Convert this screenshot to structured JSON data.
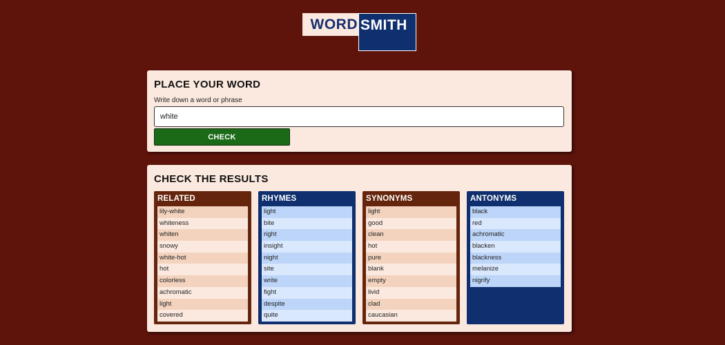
{
  "logo": {
    "word": "WORD",
    "smith": "SMITH"
  },
  "place": {
    "title": "PLACE YOUR WORD",
    "field_label": "Write down a word or phrase",
    "input_value": "white",
    "button_label": "CHECK"
  },
  "results": {
    "title": "CHECK THE RESULTS",
    "columns": [
      {
        "title": "RELATED",
        "items": [
          "lily-white",
          "whiteness",
          "whiten",
          "snowy",
          "white-hot",
          "hot",
          "colorless",
          "achromatic",
          "light",
          "covered"
        ]
      },
      {
        "title": "RHYMES",
        "items": [
          "light",
          "bite",
          "right",
          "insight",
          "night",
          "site",
          "write",
          "fight",
          "despite",
          "quite"
        ]
      },
      {
        "title": "SYNONYMS",
        "items": [
          "light",
          "good",
          "clean",
          "hot",
          "pure",
          "blank",
          "empty",
          "livid",
          "clad",
          "caucasian"
        ]
      },
      {
        "title": "ANTONYMS",
        "items": [
          "black",
          "red",
          "achromatic",
          "blacken",
          "blackness",
          "melanize",
          "nigrify"
        ]
      }
    ]
  },
  "colors": {
    "background": "#5e130b",
    "card": "#fbe9df",
    "navy": "#0f2f6e",
    "brown": "#65250c",
    "green": "#1b6a17"
  }
}
